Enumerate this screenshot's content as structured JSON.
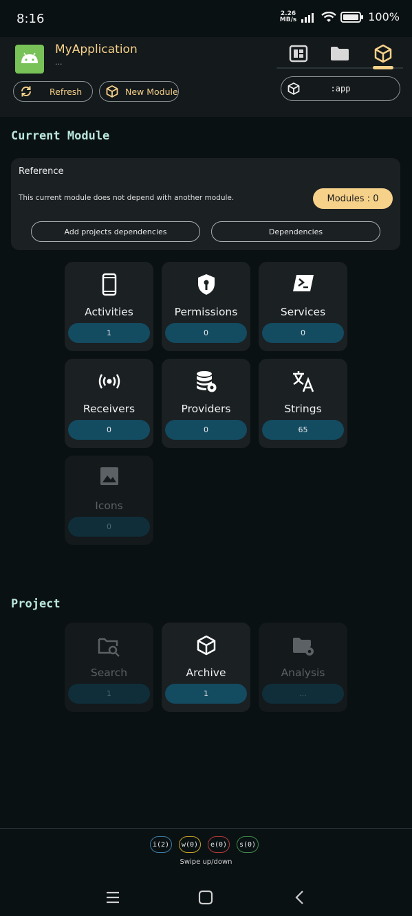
{
  "status_bar": {
    "time": "8:16",
    "net_speed_value": "2.26",
    "net_speed_unit": "MB/s",
    "battery": "100%"
  },
  "header": {
    "app_title": "MyApplication",
    "app_subtitle": "...",
    "refresh_label": "Refresh",
    "new_module_label": "New Module",
    "module_selected": ":app",
    "accent": "#f6d18a"
  },
  "current_module": {
    "section_title": "Current Module",
    "reference": {
      "title": "Reference",
      "description": "This current module does not depend with another module.",
      "modules_count": "Modules : 0",
      "add_deps_label": "Add projects dependencies",
      "deps_label": "Dependencies"
    },
    "tiles": [
      {
        "label": "Activities",
        "count": "1",
        "icon": "smartphone-icon"
      },
      {
        "label": "Permissions",
        "count": "0",
        "icon": "shield-key-icon"
      },
      {
        "label": "Services",
        "count": "0",
        "icon": "terminal-icon"
      },
      {
        "label": "Receivers",
        "count": "0",
        "icon": "broadcast-icon"
      },
      {
        "label": "Providers",
        "count": "0",
        "icon": "database-gear-icon"
      },
      {
        "label": "Strings",
        "count": "65",
        "icon": "translate-icon"
      },
      {
        "label": "Icons",
        "count": "0",
        "icon": "image-icon"
      }
    ]
  },
  "project": {
    "section_title": "Project",
    "tiles": [
      {
        "label": "Search",
        "count": "1",
        "icon": "folder-search-icon"
      },
      {
        "label": "Archive",
        "count": "1",
        "icon": "package-icon"
      },
      {
        "label": "Analysis",
        "count": "...",
        "icon": "folder-gear-icon"
      }
    ]
  },
  "logs": {
    "chips": [
      {
        "label": "i(2)",
        "color": "#3f7fa6"
      },
      {
        "label": "w(0)",
        "color": "#c9a42c"
      },
      {
        "label": "e(0)",
        "color": "#b43a3a"
      },
      {
        "label": "s(0)",
        "color": "#3f8a4a"
      }
    ],
    "hint": "Swipe up/down"
  }
}
